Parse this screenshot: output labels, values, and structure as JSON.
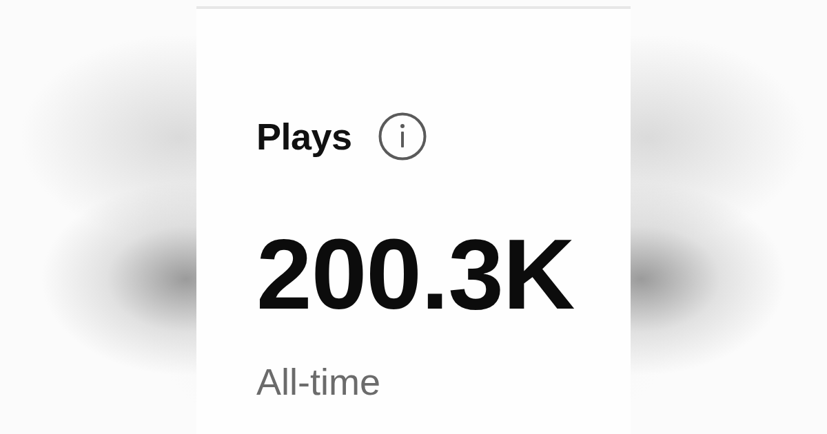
{
  "metric": {
    "label": "Plays",
    "value": "200.3K",
    "period": "All-time"
  }
}
